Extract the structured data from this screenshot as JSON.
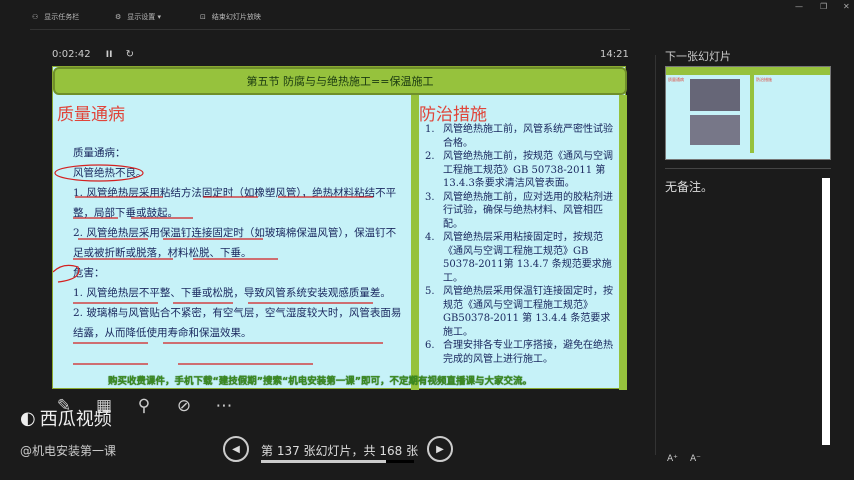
{
  "toolbar": {
    "show_taskbar": "显示任务栏",
    "display_settings": "显示设置 ▾",
    "end_show": "结束幻灯片放映"
  },
  "window": {
    "minimize": "—",
    "restore": "❐",
    "close": "✕"
  },
  "timer": {
    "elapsed": "0:02:42",
    "pause": "II",
    "restart": "↻",
    "clock": "14:21"
  },
  "slide": {
    "title": "第五节  防腐与与绝热施工==保温施工",
    "left_heading": "质量通病",
    "left_lines": [
      "质量通病：",
      "风管绝热不良。",
      "1. 风管绝热层采用粘结方法固定时（如橡塑风管），绝热材料粘结不平整，局部下垂或鼓起。",
      "2. 风管绝热层采用保温钉连接固定时（如玻璃棉保温风管），保温钉不足或被折断或脱落，材料松脱、下垂。",
      "危害：",
      "1. 风管绝热层不平整、下垂或松脱，导致风管系统安装观感质量差。",
      "2. 玻璃棉与风管贴合不紧密，有空气层，空气湿度较大时，风管表面易结露，从而降低使用寿命和保温效果。"
    ],
    "right_heading": "防治措施",
    "right_items": [
      {
        "n": "1.",
        "t": "风管绝热施工前，风管系统严密性试验合格。"
      },
      {
        "n": "2.",
        "t": "风管绝热施工前，按规范《通风与空调工程施工规范》GB 50738-2011 第13.4.3条要求清洁风管表面。"
      },
      {
        "n": "3.",
        "t": "风管绝热施工前，应对选用的胶粘剂进行试验，确保与绝热材料、风管相匹配。"
      },
      {
        "n": "4.",
        "t": "风管绝热层采用粘接固定时，按规范《通风与空调工程施工规范》GB 50378-2011第 13.4.7 条规范要求施工。"
      },
      {
        "n": "5.",
        "t": "风管绝热层采用保温钉连接固定时，按规范《通风与空调工程施工规范》GB50378-2011 第 13.4.4 条范要求施工。"
      },
      {
        "n": "6.",
        "t": "合理安排各专业工序搭接，避免在绝热完成的风管上进行施工。"
      }
    ],
    "banner": "购买收费课件，手机下载“建技假期”搜索“机电安装第一课”即可，不定期有视频直播课与大家交流。"
  },
  "tools": [
    "pen-icon",
    "grid-icon",
    "search-icon",
    "screen-icon",
    "more-icon"
  ],
  "watermark": "西瓜视频",
  "handle": "@机电安装第一课",
  "nav": {
    "prev": "◀",
    "next": "▶",
    "counter": "第 137 张幻灯片，共 168 张",
    "current": 137,
    "total": 168
  },
  "right": {
    "next_label": "下一张幻灯片",
    "next_thumb_left": "质量通病",
    "next_thumb_right": "防治措施",
    "notes": "无备注。",
    "font_up": "A⁺",
    "font_down": "A⁻"
  },
  "colors": {
    "slide_bg": "#c6f2f8",
    "header_green": "#96c23d",
    "heading_red": "#e0453a",
    "ink": "#d42020"
  }
}
